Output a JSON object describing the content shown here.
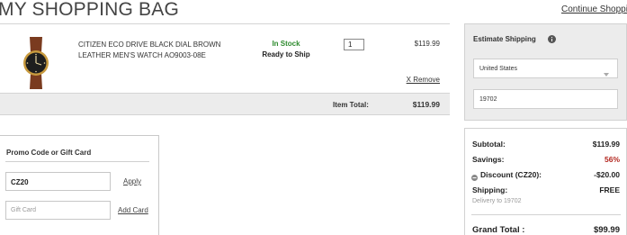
{
  "header": {
    "title": "My Shopping Bag",
    "continue_link": "Continue Shopping"
  },
  "item": {
    "name": "Citizen Eco Drive Black Dial Brown Leather Men's Watch AO9003-08E",
    "stock_status": "In Stock",
    "ship_status": "Ready to Ship",
    "quantity": "1",
    "price": "$119.99",
    "remove_link": "X Remove",
    "image_icon": "watch-icon"
  },
  "item_total": {
    "label": "Item Total:",
    "value": "$119.99"
  },
  "promo": {
    "heading": "Promo Code or Gift Card",
    "code_value": "CZ20",
    "apply_label": "Apply",
    "gift_placeholder": "Gift Card",
    "add_card_label": "Add Card"
  },
  "estimate": {
    "heading": "Estimate Shipping",
    "info_icon": "info-icon",
    "country": "United States",
    "zip": "19702"
  },
  "summary": {
    "subtotal_label": "Subtotal:",
    "subtotal_value": "$119.99",
    "savings_label": "Savings:",
    "savings_value": "56%",
    "discount_label": "Discount (CZ20):",
    "discount_value": "-$20.00",
    "shipping_label": "Shipping:",
    "shipping_value": "FREE",
    "delivery_note": "Delivery to 19702",
    "grand_total_label": "Grand Total :",
    "grand_total_value": "$99.99"
  },
  "colors": {
    "in_stock": "#2e8b2e",
    "savings": "#b3261e",
    "panel_bg": "#ececec"
  }
}
